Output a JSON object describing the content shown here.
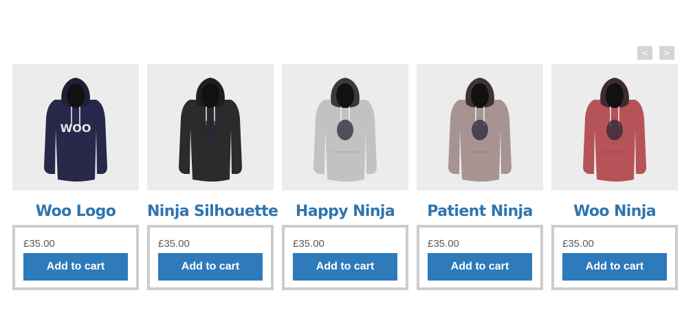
{
  "carousel": {
    "prev_label": "<",
    "next_label": ">",
    "products": [
      {
        "title": "Woo Logo",
        "price": "£35.00",
        "button": "Add to cart",
        "color": "#27284a",
        "hood": "#1f2038",
        "graphic": "WOO"
      },
      {
        "title": "Ninja Silhouette",
        "price": "£35.00",
        "button": "Add to cart",
        "color": "#2b2b2b",
        "hood": "#1e1e1e",
        "graphic": ""
      },
      {
        "title": "Happy Ninja",
        "price": "£35.00",
        "button": "Add to cart",
        "color": "#c2c2c2",
        "hood": "#3a3a3a",
        "graphic": ""
      },
      {
        "title": "Patient Ninja",
        "price": "£35.00",
        "button": "Add to cart",
        "color": "#a89393",
        "hood": "#3d3435",
        "graphic": ""
      },
      {
        "title": "Woo Ninja",
        "price": "£35.00",
        "button": "Add to cart",
        "color": "#b65358",
        "hood": "#3f2a2c",
        "graphic": ""
      }
    ]
  }
}
